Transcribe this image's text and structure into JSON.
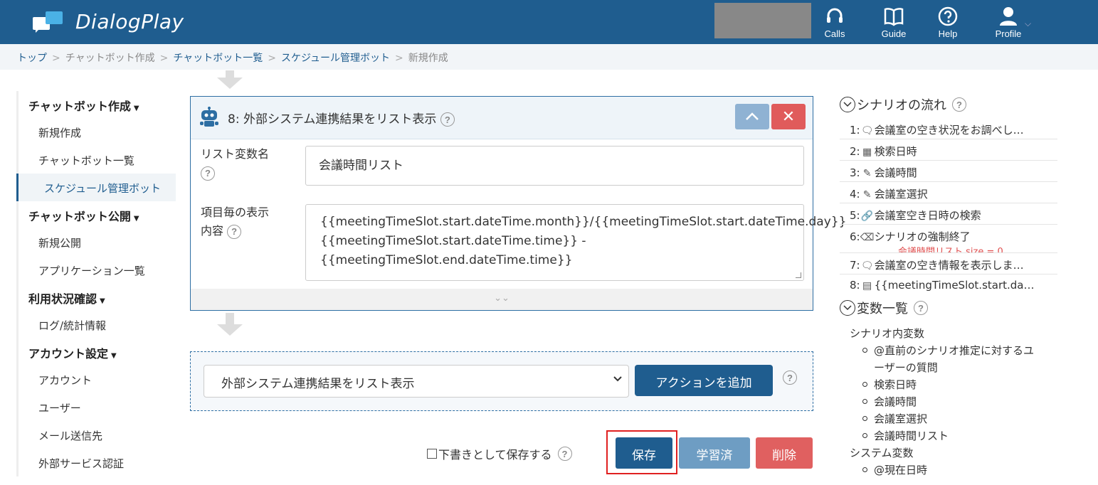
{
  "header": {
    "brand": "DialogPlay",
    "nav": [
      {
        "label": "Calls",
        "icon": "headset-icon"
      },
      {
        "label": "Guide",
        "icon": "book-icon"
      },
      {
        "label": "Help",
        "icon": "help-circle-icon"
      },
      {
        "label": "Profile",
        "icon": "user-icon"
      }
    ]
  },
  "breadcrumb": [
    {
      "label": "トップ",
      "link": true
    },
    {
      "label": "チャットボット作成",
      "link": false
    },
    {
      "label": "チャットボット一覧",
      "link": true
    },
    {
      "label": "スケジュール管理ボット",
      "link": true
    },
    {
      "label": "新規作成",
      "link": false
    }
  ],
  "breadcrumb_sep": ">",
  "sidebar": {
    "sections": [
      {
        "title": "チャットボット作成",
        "items": [
          "新規作成",
          "チャットボット一覧",
          "スケジュール管理ボット"
        ]
      },
      {
        "title": "チャットボット公開",
        "items": [
          "新規公開",
          "アプリケーション一覧"
        ]
      },
      {
        "title": "利用状況確認",
        "items": [
          "ログ/統計情報"
        ]
      },
      {
        "title": "アカウント設定",
        "items": [
          "アカウント",
          "ユーザー",
          "メール送信先",
          "外部サービス認証"
        ]
      }
    ],
    "active_item": "スケジュール管理ボット"
  },
  "action_card": {
    "title": "8: 外部システム連携結果をリスト表示",
    "list_var_label": "リスト変数名",
    "list_var_value": "会議時間リスト",
    "display_label_1": "項目毎の表示",
    "display_label_2": "内容",
    "display_value": "{{meetingTimeSlot.start.dateTime.month}}/{{meetingTimeSlot.start.dateTime.day}} {{meetingTimeSlot.start.dateTime.time}} - {{meetingTimeSlot.end.dateTime.time}}",
    "close_label": "✕"
  },
  "add_action": {
    "selected": "外部システム連携結果をリスト表示",
    "button": "アクションを追加"
  },
  "footer": {
    "draft_label": "下書きとして保存する",
    "save": "保存",
    "learned": "学習済",
    "delete": "削除"
  },
  "help_glyph": "?",
  "right_panel": {
    "flow_title": "シナリオの流れ",
    "flow": [
      {
        "num": "1:",
        "icon": "speech-bubble-icon",
        "text": "会議室の空き状況をお調べし…"
      },
      {
        "num": "2:",
        "icon": "calendar-icon",
        "text": "検索日時"
      },
      {
        "num": "3:",
        "icon": "choice-icon",
        "text": "会議時間"
      },
      {
        "num": "4:",
        "icon": "choice-icon",
        "text": "会議室選択"
      },
      {
        "num": "5:",
        "icon": "link-icon",
        "text": "会議室空き日時の検索"
      },
      {
        "num": "6:",
        "icon": "exit-icon",
        "text": "シナリオの強制終了",
        "condition": "会議時間リスト.size = 0"
      },
      {
        "num": "7:",
        "icon": "speech-bubble-icon",
        "text": "会議室の空き情報を表示しま…"
      },
      {
        "num": "8:",
        "icon": "list-icon",
        "text": "{{meetingTimeSlot.start.da…"
      }
    ],
    "vars_title": "変数一覧",
    "scenario_vars_label": "シナリオ内変数",
    "scenario_vars": [
      "@直前のシナリオ推定に対するユ",
      "ーザーの質問",
      "検索日時",
      "会議時間",
      "会議室選択",
      "会議時間リスト"
    ],
    "system_vars_label": "システム変数",
    "system_vars": [
      "@現在日時"
    ]
  }
}
